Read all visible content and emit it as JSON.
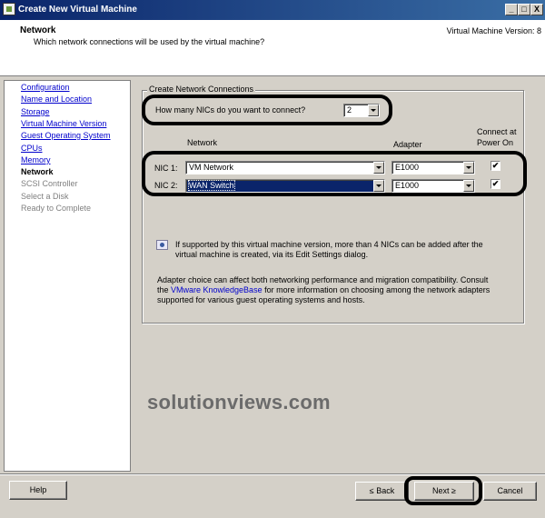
{
  "window": {
    "title": "Create New Virtual Machine",
    "minimize": "_",
    "maximize": "□",
    "close": "X"
  },
  "header": {
    "title": "Network",
    "subtitle": "Which network connections will be used by the virtual machine?",
    "version": "Virtual Machine Version: 8"
  },
  "sidebar": {
    "steps": [
      {
        "label": "Configuration",
        "state": "link"
      },
      {
        "label": "Name and Location",
        "state": "link"
      },
      {
        "label": "Storage",
        "state": "link"
      },
      {
        "label": "Virtual Machine Version",
        "state": "link"
      },
      {
        "label": "Guest Operating System",
        "state": "link"
      },
      {
        "label": "CPUs",
        "state": "link"
      },
      {
        "label": "Memory",
        "state": "link"
      },
      {
        "label": "Network",
        "state": "current"
      },
      {
        "label": "SCSI Controller",
        "state": "disabled"
      },
      {
        "label": "Select a Disk",
        "state": "disabled"
      },
      {
        "label": "Ready to Complete",
        "state": "disabled"
      }
    ]
  },
  "main": {
    "group_label": "Create Network Connections",
    "nic_count_question": "How many NICs do you want to connect?",
    "nic_count_value": "2",
    "columns": {
      "network": "Network",
      "adapter": "Adapter",
      "connect_line1": "Connect at",
      "connect_line2": "Power On"
    },
    "nics": [
      {
        "label": "NIC 1:",
        "network": "VM Network",
        "adapter": "E1000",
        "connect": "✔"
      },
      {
        "label": "NIC 2:",
        "network": "WAN Switch",
        "adapter": "E1000",
        "connect": "✔"
      }
    ],
    "info_text_1": "If supported by this virtual machine version, more than 4 NICs can be added after the",
    "info_text_2": "virtual machine is created, via its Edit Settings dialog.",
    "adapter_text_1": "Adapter choice can affect both networking performance and migration compatibility. Consult",
    "adapter_text_2a": "the ",
    "adapter_link": "VMware KnowledgeBase",
    "adapter_text_2b": " for more information on choosing among the network adapters",
    "adapter_text_3": "supported for various guest operating systems and hosts."
  },
  "watermark": "solutionviews.com",
  "footer": {
    "help": "Help",
    "back": "≤ Back",
    "next": "Next ≥",
    "cancel": "Cancel"
  }
}
